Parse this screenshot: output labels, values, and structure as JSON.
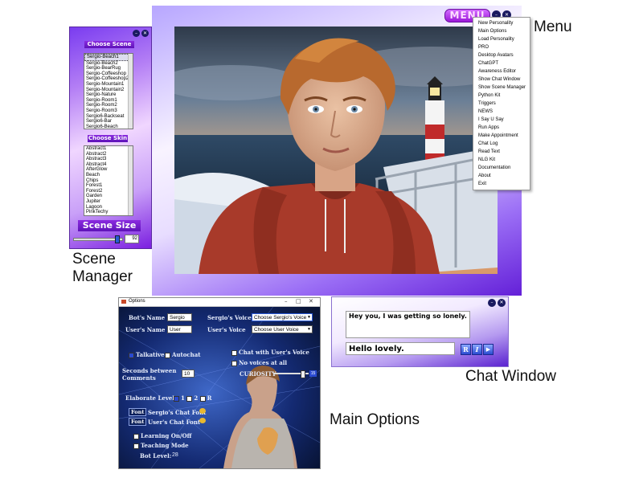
{
  "captions": {
    "menu": "Menu",
    "scene_manager": "Scene\nManager",
    "chat_window": "Chat Window",
    "main_options": "Main Options"
  },
  "scene_manager": {
    "choose_scene_title": "Choose Scene",
    "scenes": [
      "Sergio-Beach1",
      "Sergio-Beach2",
      "Sergio-BearRug",
      "Sergio-Coffeeshop",
      "Sergio-Coffeeshop2",
      "Sergio-Mountain1",
      "Sergio-Mountain2",
      "Sergio-Nature",
      "Sergio-Room1",
      "Sergio-Room2",
      "Sergio-Room3",
      "Sergio6-Backseat",
      "Sergio6-Bar",
      "Sergio6-Beach"
    ],
    "selected_scene": "Sergio-Beach1",
    "choose_skin_title": "Choose Skin",
    "skins": [
      "Abstract1",
      "Abstract2",
      "Abstract3",
      "Abstract4",
      "AfterGlow",
      "Beach",
      "Chips",
      "Forest1",
      "Forest2",
      "Garden",
      "Jupiter",
      "Lagoon",
      "PinkTechy"
    ],
    "scene_size_title": "Scene Size",
    "scene_size_value": "92",
    "scene_size_fraction": 0.92
  },
  "menu": {
    "button_label": "MENU",
    "items": [
      "New Personality",
      "Main Options",
      "Load Personality",
      "PRO",
      "Desktop Avatars",
      "ChatGPT",
      "Awareness Editor",
      "Show Chat Window",
      "Show Scene Manager",
      "Python Kit",
      "Triggers",
      "NEWS",
      "I Say U Say",
      "Run Apps",
      "Make Appointment",
      "Chat Log",
      "Read Text",
      "NLG Kit",
      "Documentation",
      "About",
      "Exit"
    ]
  },
  "options": {
    "title": "Options",
    "bots_name_label": "Bot's Name",
    "bots_name_value": "Sergio",
    "users_name_label": "User's Name",
    "users_name_value": "User",
    "sergios_voice_label": "Sergio's Voice",
    "sergios_voice_value": "Choose Sergio's Voice",
    "users_voice_label": "User's Voice",
    "users_voice_value": "Choose User Voice",
    "talkative_label": "Talkative",
    "autochat_label": "Autochat",
    "chat_with_users_voice_label": "Chat with User's Voice",
    "no_voices_label": "No voices at all",
    "curiosity_label": "CURIOSITY",
    "curiosity_value": "15",
    "curiosity_fraction": 0.85,
    "seconds_between_label": "Seconds between",
    "comments_label": "Comments",
    "seconds_value": "10",
    "elaborate_label": "Elaborate Level",
    "elaborate_options": [
      "1",
      "2",
      "R"
    ],
    "font_button": "Font",
    "sergios_chat_font_label": "Sergio's Chat Font",
    "users_chat_font_label": "User's Chat Font",
    "learning_label": "Learning On/Off",
    "teaching_label": "Teaching Mode",
    "bot_level_label": "Bot Level:",
    "bot_level_value": "28"
  },
  "chat": {
    "bot_message": "Hey you, I was getting so lonely.",
    "user_input": "Hello lovely.",
    "btn_r": "R",
    "btn_i": "I",
    "btn_send": "▶"
  },
  "colors": {
    "menu_button": "#b52ae8",
    "title_purple": "#7a20d0",
    "options_bg": "#0a1a4a",
    "chat_button": "#2a4ad0"
  }
}
